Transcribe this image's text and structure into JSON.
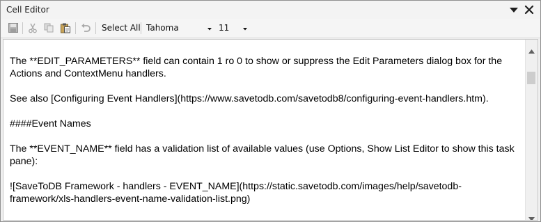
{
  "window": {
    "title": "Cell Editor",
    "icons": [
      "dropdown-arrow-icon",
      "close-icon"
    ]
  },
  "toolbar": {
    "icons": [
      "save-icon",
      "cut-icon",
      "copy-icon",
      "paste-icon",
      "undo-icon"
    ],
    "select_all_label": "Select All",
    "font_name": "Tahoma",
    "font_size": "11"
  },
  "editor": {
    "paragraphs": [
      "The **EDIT_PARAMETERS** field can contain 1 ro 0 to show or suppress the Edit Parameters dialog box for the Actions and ContextMenu handlers.",
      "See also [Configuring Event Handlers](https://www.savetodb.com/savetodb8/configuring-event-handlers.htm).",
      "####Event Names",
      "The **EVENT_NAME** field has a validation list of available values (use Options, Show List Editor to show this task pane):",
      "![SaveToDB Framework - handlers - EVENT_NAME](https://static.savetodb.com/images/help/savetodb-framework/xls-handlers-event-name-validation-list.png)"
    ]
  },
  "colors": {
    "window_bg": "#f0f0f0",
    "editor_bg": "#ffffff",
    "border": "#8f8f8f"
  }
}
